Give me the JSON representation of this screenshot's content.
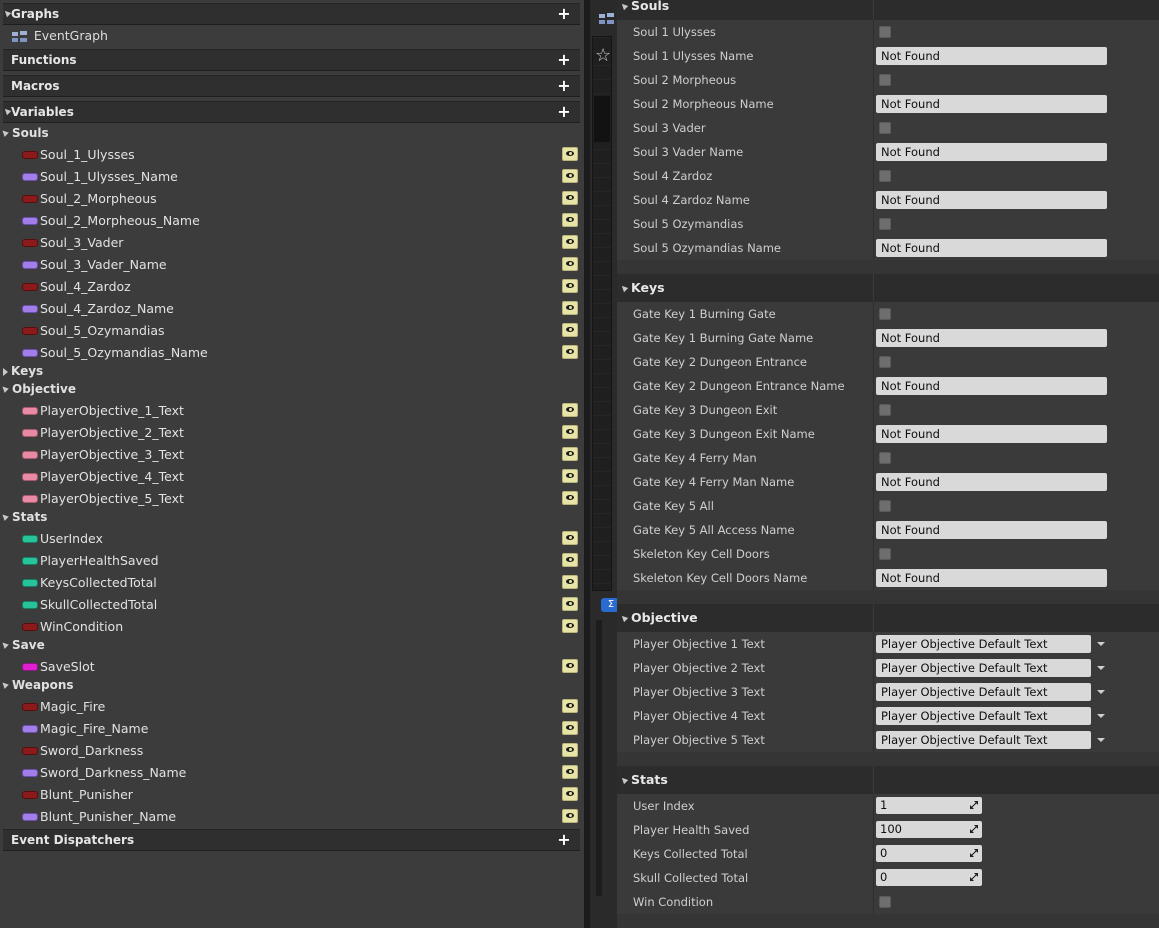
{
  "left": {
    "graphs": {
      "title": "Graphs",
      "event_graph": "EventGraph"
    },
    "functions": {
      "title": "Functions"
    },
    "macros": {
      "title": "Macros"
    },
    "variables": {
      "title": "Variables"
    },
    "event_dispatchers": {
      "title": "Event Dispatchers"
    },
    "groups": {
      "souls": {
        "title": "Souls",
        "items": [
          {
            "name": "Soul_1_Ulysses",
            "type": "bool"
          },
          {
            "name": "Soul_1_Ulysses_Name",
            "type": "name"
          },
          {
            "name": "Soul_2_Morpheous",
            "type": "bool"
          },
          {
            "name": "Soul_2_Morpheous_Name",
            "type": "name"
          },
          {
            "name": "Soul_3_Vader",
            "type": "bool"
          },
          {
            "name": "Soul_3_Vader_Name",
            "type": "name"
          },
          {
            "name": "Soul_4_Zardoz",
            "type": "bool"
          },
          {
            "name": "Soul_4_Zardoz_Name",
            "type": "name"
          },
          {
            "name": "Soul_5_Ozymandias",
            "type": "bool"
          },
          {
            "name": "Soul_5_Ozymandias_Name",
            "type": "name"
          }
        ]
      },
      "keys": {
        "title": "Keys"
      },
      "objective": {
        "title": "Objective",
        "items": [
          {
            "name": "PlayerObjective_1_Text",
            "type": "text"
          },
          {
            "name": "PlayerObjective_2_Text",
            "type": "text"
          },
          {
            "name": "PlayerObjective_3_Text",
            "type": "text"
          },
          {
            "name": "PlayerObjective_4_Text",
            "type": "text"
          },
          {
            "name": "PlayerObjective_5_Text",
            "type": "text"
          }
        ]
      },
      "stats": {
        "title": "Stats",
        "items": [
          {
            "name": "UserIndex",
            "type": "int"
          },
          {
            "name": "PlayerHealthSaved",
            "type": "int"
          },
          {
            "name": "KeysCollectedTotal",
            "type": "int"
          },
          {
            "name": "SkullCollectedTotal",
            "type": "int"
          },
          {
            "name": "WinCondition",
            "type": "bool"
          }
        ]
      },
      "save": {
        "title": "Save",
        "items": [
          {
            "name": "SaveSlot",
            "type": "object"
          }
        ]
      },
      "weapons": {
        "title": "Weapons",
        "items": [
          {
            "name": "Magic_Fire",
            "type": "bool"
          },
          {
            "name": "Magic_Fire_Name",
            "type": "name"
          },
          {
            "name": "Sword_Darkness",
            "type": "bool"
          },
          {
            "name": "Sword_Darkness_Name",
            "type": "name"
          },
          {
            "name": "Blunt_Punisher",
            "type": "bool"
          },
          {
            "name": "Blunt_Punisher_Name",
            "type": "name"
          }
        ]
      }
    }
  },
  "details": {
    "souls": {
      "title": "Souls",
      "rows": [
        {
          "label": "Soul 1 Ulysses",
          "kind": "checkbox",
          "checked": false
        },
        {
          "label": "Soul 1 Ulysses Name",
          "kind": "text",
          "value": "Not Found"
        },
        {
          "label": "Soul 2 Morpheous",
          "kind": "checkbox",
          "checked": false
        },
        {
          "label": "Soul 2 Morpheous Name",
          "kind": "text",
          "value": "Not Found"
        },
        {
          "label": "Soul 3 Vader",
          "kind": "checkbox",
          "checked": false
        },
        {
          "label": "Soul 3 Vader Name",
          "kind": "text",
          "value": "Not Found"
        },
        {
          "label": "Soul 4 Zardoz",
          "kind": "checkbox",
          "checked": false
        },
        {
          "label": "Soul 4 Zardoz Name",
          "kind": "text",
          "value": "Not Found"
        },
        {
          "label": "Soul 5 Ozymandias",
          "kind": "checkbox",
          "checked": false
        },
        {
          "label": "Soul 5 Ozymandias Name",
          "kind": "text",
          "value": "Not Found"
        }
      ]
    },
    "keys": {
      "title": "Keys",
      "rows": [
        {
          "label": "Gate Key 1 Burning Gate",
          "kind": "checkbox",
          "checked": false
        },
        {
          "label": "Gate Key 1 Burning Gate Name",
          "kind": "text",
          "value": "Not Found"
        },
        {
          "label": "Gate Key 2 Dungeon Entrance",
          "kind": "checkbox",
          "checked": false
        },
        {
          "label": "Gate Key 2 Dungeon Entrance Name",
          "kind": "text",
          "value": "Not Found"
        },
        {
          "label": "Gate Key 3 Dungeon Exit",
          "kind": "checkbox",
          "checked": false
        },
        {
          "label": "Gate Key 3 Dungeon Exit Name",
          "kind": "text",
          "value": "Not Found"
        },
        {
          "label": "Gate Key 4 Ferry Man",
          "kind": "checkbox",
          "checked": false
        },
        {
          "label": "Gate Key 4 Ferry Man Name",
          "kind": "text",
          "value": "Not Found"
        },
        {
          "label": "Gate Key 5 All",
          "kind": "checkbox",
          "checked": false
        },
        {
          "label": "Gate Key 5 All Access Name",
          "kind": "text",
          "value": "Not Found"
        },
        {
          "label": "Skeleton Key Cell Doors",
          "kind": "checkbox",
          "checked": false
        },
        {
          "label": "Skeleton Key Cell Doors Name",
          "kind": "text",
          "value": "Not Found"
        }
      ]
    },
    "objective": {
      "title": "Objective",
      "rows": [
        {
          "label": "Player Objective 1 Text",
          "kind": "combo",
          "value": "Player Objective Default Text"
        },
        {
          "label": "Player Objective 2 Text",
          "kind": "combo",
          "value": "Player Objective Default Text"
        },
        {
          "label": "Player Objective 3 Text",
          "kind": "combo",
          "value": "Player Objective Default Text"
        },
        {
          "label": "Player Objective 4 Text",
          "kind": "combo",
          "value": "Player Objective Default Text"
        },
        {
          "label": "Player Objective 5 Text",
          "kind": "combo",
          "value": "Player Objective Default Text"
        }
      ]
    },
    "stats": {
      "title": "Stats",
      "rows": [
        {
          "label": "User Index",
          "kind": "number",
          "value": "1"
        },
        {
          "label": "Player Health Saved",
          "kind": "number",
          "value": "100"
        },
        {
          "label": "Keys Collected Total",
          "kind": "number",
          "value": "0"
        },
        {
          "label": "Skull Collected Total",
          "kind": "number",
          "value": "0"
        },
        {
          "label": "Win Condition",
          "kind": "checkbox",
          "checked": false
        }
      ]
    }
  },
  "colors": {
    "bool": "#8b1a1a",
    "name": "#a37ee8",
    "text": "#e88aa4",
    "int": "#29c39a",
    "object": "#e020d0"
  }
}
